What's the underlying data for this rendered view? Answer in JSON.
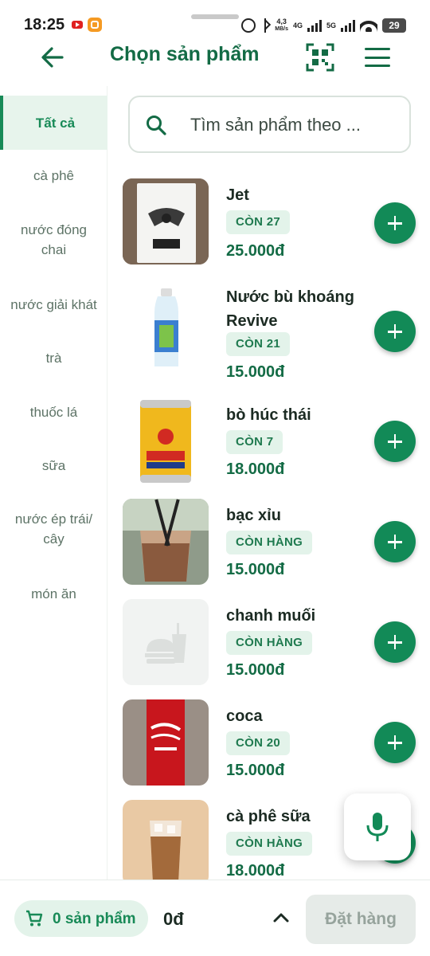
{
  "status": {
    "time": "18:25",
    "net_speed_top": "4,3",
    "net_speed_unit": "MB/s",
    "sim1": "4G",
    "sim2": "5G",
    "battery": "29"
  },
  "header": {
    "title": "Chọn sản phẩm",
    "icons": [
      "back-arrow-icon",
      "qr-scan-icon",
      "menu-icon"
    ]
  },
  "sidebar": {
    "items": [
      {
        "label": "Tất cả",
        "active": true
      },
      {
        "label": "cà phê"
      },
      {
        "label": "nước đóng chai"
      },
      {
        "label": "nước giải khát"
      },
      {
        "label": "trà"
      },
      {
        "label": "thuốc lá"
      },
      {
        "label": "sữa"
      },
      {
        "label": "nước ép trái/ cây"
      },
      {
        "label": "món ăn"
      }
    ]
  },
  "search": {
    "placeholder": "Tìm sản phẩm theo ..."
  },
  "products": [
    {
      "name": "Jet",
      "stock": "CÒN 27",
      "price": "25.000đ"
    },
    {
      "name": "Nước bù khoáng Revive",
      "stock": "CÒN 21",
      "price": "15.000đ"
    },
    {
      "name": "bò húc thái",
      "stock": "CÒN 7",
      "price": "18.000đ"
    },
    {
      "name": "bạc xỉu",
      "stock": "CÒN HÀNG",
      "price": "15.000đ"
    },
    {
      "name": "chanh muối",
      "stock": "CÒN HÀNG",
      "price": "15.000đ"
    },
    {
      "name": "coca",
      "stock": "CÒN 20",
      "price": "15.000đ"
    },
    {
      "name": "cà phê sữa",
      "stock": "CÒN HÀNG",
      "price": "18.000đ"
    }
  ],
  "cart": {
    "label": "0 sản phẩm",
    "total": "0đ",
    "order_button": "Đặt hàng"
  },
  "colors": {
    "primary": "#128a57",
    "primary_dark": "#136b45",
    "chip_bg": "#e3f3ea"
  }
}
